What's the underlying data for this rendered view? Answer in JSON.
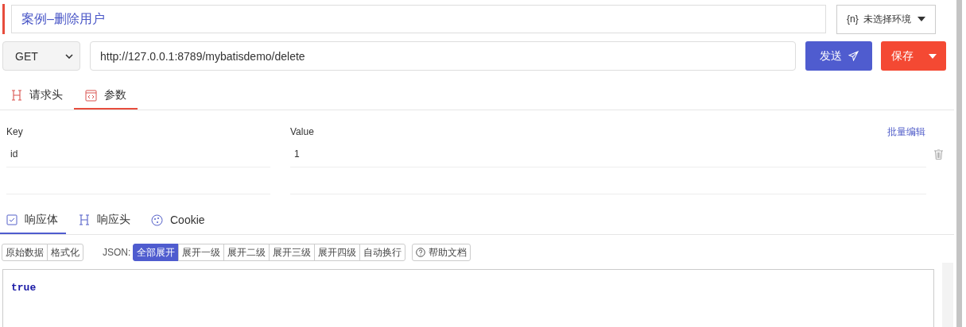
{
  "title": {
    "value": "案例–删除用户"
  },
  "environment": {
    "icon_text": "{n}",
    "label": "未选择环境"
  },
  "request": {
    "method": "GET",
    "url": "http://127.0.0.1:8789/mybatisdemo/delete",
    "send_label": "发送",
    "save_label": "保存"
  },
  "request_tabs": [
    {
      "label": "请求头",
      "kind": "heading",
      "selected": false
    },
    {
      "label": "参数",
      "kind": "code",
      "selected": true
    }
  ],
  "params": {
    "key_header": "Key",
    "value_header": "Value",
    "bulk_edit": "批量编辑",
    "rows": [
      {
        "key": "id",
        "value": "1"
      }
    ]
  },
  "response_tabs": [
    {
      "label": "响应体",
      "kind": "check",
      "selected": true
    },
    {
      "label": "响应头",
      "kind": "heading",
      "selected": false
    },
    {
      "label": "Cookie",
      "kind": "cookie",
      "selected": false
    }
  ],
  "toolbar": {
    "view_modes": [
      {
        "label": "原始数据",
        "selected": false
      },
      {
        "label": "格式化",
        "selected": false
      }
    ],
    "json_label": "JSON:",
    "json_options": [
      {
        "label": "全部展开",
        "selected": true
      },
      {
        "label": "展开一级",
        "selected": false
      },
      {
        "label": "展开二级",
        "selected": false
      },
      {
        "label": "展开三级",
        "selected": false
      },
      {
        "label": "展开四级",
        "selected": false
      },
      {
        "label": "自动换行",
        "selected": false
      }
    ],
    "help_label": "帮助文档"
  },
  "response_body": "true"
}
